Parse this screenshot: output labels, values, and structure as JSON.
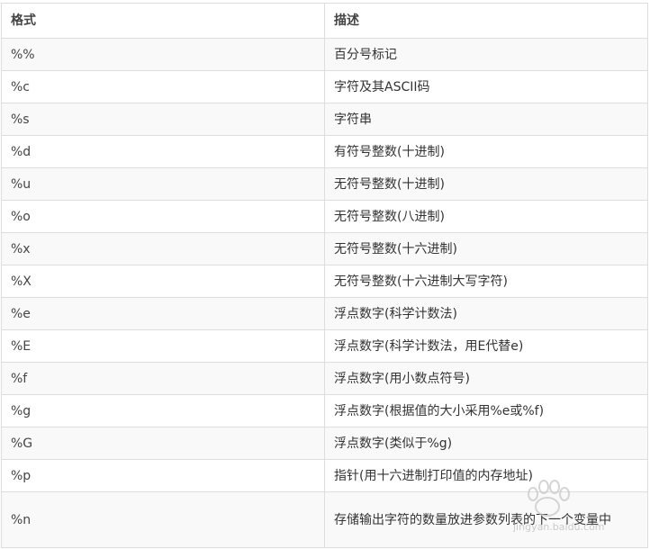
{
  "table": {
    "headers": [
      "格式",
      "描述"
    ],
    "rows": [
      {
        "format": "%%",
        "description": "百分号标记"
      },
      {
        "format": "%c",
        "description": "字符及其ASCII码"
      },
      {
        "format": "%s",
        "description": "字符串"
      },
      {
        "format": "%d",
        "description": "有符号整数(十进制)"
      },
      {
        "format": "%u",
        "description": "无符号整数(十进制)"
      },
      {
        "format": "%o",
        "description": "无符号整数(八进制)"
      },
      {
        "format": "%x",
        "description": "无符号整数(十六进制)"
      },
      {
        "format": "%X",
        "description": "无符号整数(十六进制大写字符)"
      },
      {
        "format": "%e",
        "description": "浮点数字(科学计数法)"
      },
      {
        "format": "%E",
        "description": "浮点数字(科学计数法，用E代替e)"
      },
      {
        "format": "%f",
        "description": "浮点数字(用小数点符号)"
      },
      {
        "format": "%g",
        "description": "浮点数字(根据值的大小采用%e或%f)"
      },
      {
        "format": "%G",
        "description": "浮点数字(类似于%g)"
      },
      {
        "format": "%p",
        "description": "指针(用十六进制打印值的内存地址)"
      },
      {
        "format": "%n",
        "description": "存储输出字符的数量放进参数列表的下一个变量中"
      }
    ]
  },
  "watermark": {
    "text": "jingyan.baidu.com"
  }
}
